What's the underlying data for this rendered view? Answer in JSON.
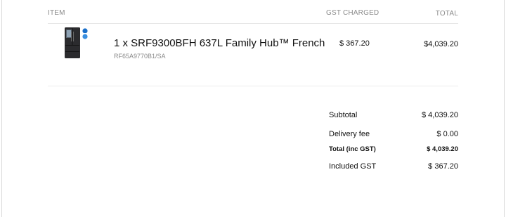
{
  "header": {
    "item_label": "ITEM",
    "gst_label": "GST CHARGED",
    "total_label": "TOTAL"
  },
  "item": {
    "name": "1 x SRF9300BFH 637L Family Hub™ French",
    "sku": "RF65A9770B1/SA",
    "gst": "$ 367.20",
    "total": "$4,039.20",
    "thumbnail_icon": "refrigerator-icon"
  },
  "summary": {
    "subtotal_label": "Subtotal",
    "subtotal_value": "$ 4,039.20",
    "delivery_label": "Delivery fee",
    "delivery_value": "$ 0.00",
    "total_label": "Total (inc GST)",
    "total_value": "$ 4,039.20",
    "gst_label": "Included GST",
    "gst_value": "$ 367.20"
  }
}
